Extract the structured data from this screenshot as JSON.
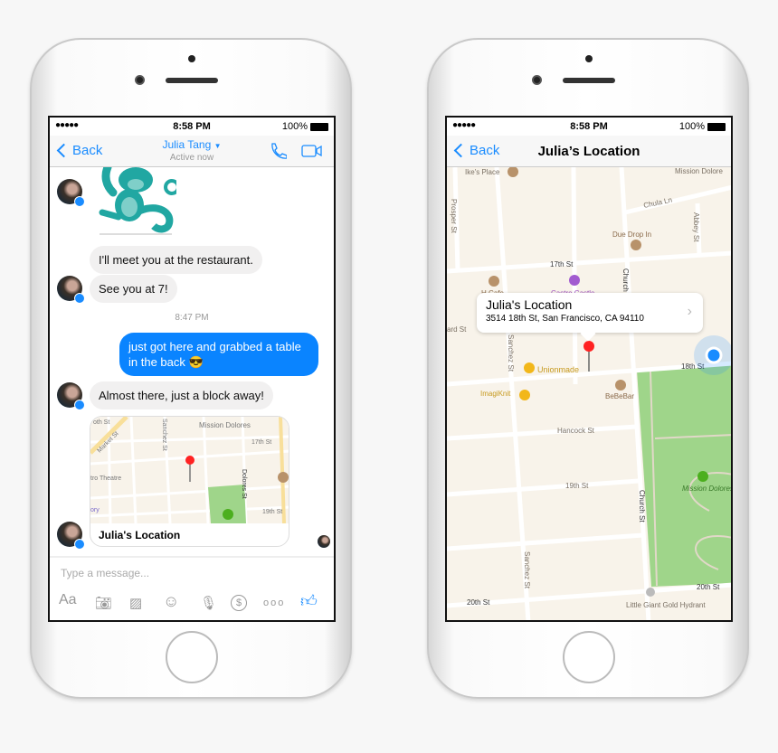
{
  "status": {
    "time": "8:58 PM",
    "battery": "100%",
    "signal": "●●●●●"
  },
  "chat": {
    "back_label": "Back",
    "contact_name": "Julia Tang",
    "contact_status": "Active now",
    "icons": [
      "phone-icon",
      "video-icon"
    ],
    "messages": [
      {
        "from": "them",
        "type": "sticker",
        "label": "monkey-sticker"
      },
      {
        "from": "them",
        "text": "I'll meet you at the restaurant."
      },
      {
        "from": "them",
        "text": "See you at 7!"
      },
      {
        "type": "timestamp",
        "text": "8:47 PM"
      },
      {
        "from": "me",
        "text": "just got here and grabbed a table in the back 😎"
      },
      {
        "from": "them",
        "text": "Almost there, just a block away!"
      },
      {
        "from": "them",
        "type": "location",
        "title": "Julia's Location"
      }
    ],
    "card_map_labels": {
      "mission_dolores": "Mission Dolores",
      "market": "Market St",
      "sanchez": "Sanchez St",
      "theatre": "tro Theatre",
      "st17": "17th St",
      "dolores": "Dolores St",
      "st19": "19th St",
      "ory": "ory",
      "th": "oth St"
    },
    "input_placeholder": "Type a message...",
    "toolbar": {
      "aa": "Aa",
      "more": "ooo"
    }
  },
  "map": {
    "back_label": "Back",
    "title": "Julia’s Location",
    "callout": {
      "title": "Julia's Location",
      "address": "3514 18th St, San Francisco, CA 94110"
    },
    "labels": {
      "ikes": "Ike's Place",
      "mission_dolores": "Mission Dolore",
      "prosper": "Prosper St",
      "chula": "Chula Ln",
      "abbey": "Abbey St",
      "due_drop": "Due Drop In",
      "st17": "17th St",
      "church": "Church",
      "hcafe": "H Cafe",
      "castro_castle": "Castro Castle",
      "ard": "ard St",
      "sanchez": "Sanchez St",
      "unionmade": "Unionmade",
      "st18": "18th St",
      "imagiknit": "ImagiKnit",
      "bebebar": "BeBeBar",
      "hancock": "Hancock St",
      "st19": "19th St",
      "church_st": "Church St",
      "park": "Mission Dolores Park",
      "sanchez2": "Sanchez St",
      "st20a": "20th St",
      "st20b": "20th St",
      "hydrant": "Little Giant Gold Hydrant"
    },
    "colors": {
      "land": "#f8f3ea",
      "road": "#ffffff",
      "park": "#9fd58a",
      "accent": "#1a8cff",
      "pin": "#f22"
    }
  }
}
